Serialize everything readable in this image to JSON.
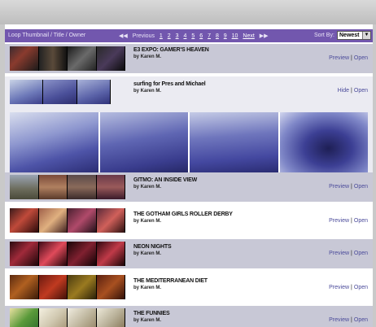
{
  "header": {
    "breadcrumb": "Loop Thumbnail / Title / Owner",
    "prev_label": "Previous",
    "next_label": "Next",
    "pages": [
      "1",
      "2",
      "3",
      "4",
      "5",
      "6",
      "7",
      "8",
      "9",
      "10"
    ],
    "sort_label": "Sort By:",
    "sort_value": "Newest"
  },
  "items": [
    {
      "title": "E3 EXPO: GAMER'S HEAVEN",
      "owner": "by Karen M.",
      "preview": "Preview",
      "open": "Open"
    },
    {
      "title": "surfing for Pres and Michael",
      "owner": "by Karen M.",
      "hide": "Hide",
      "open": "Open"
    },
    {
      "title": "GITMO: AN INSIDE VIEW",
      "owner": "by Karen M.",
      "preview": "Preview",
      "open": "Open"
    },
    {
      "title": "THE GOTHAM GIRLS ROLLER DERBY",
      "owner": "by Karen M.",
      "preview": "Preview",
      "open": "Open"
    },
    {
      "title": "NEON NIGHTS",
      "owner": "by Karen M.",
      "preview": "Preview",
      "open": "Open"
    },
    {
      "title": "THE MEDITERRANEAN DIET",
      "owner": "by Karen M.",
      "preview": "Preview",
      "open": "Open"
    },
    {
      "title": "THE FUNNIES",
      "owner": "by Karen M.",
      "preview": "Preview",
      "open": "Open"
    }
  ],
  "colors": {
    "toolbar": "#7257ae",
    "row_shade": "#c8c8d6",
    "link": "#4a4a9a"
  }
}
